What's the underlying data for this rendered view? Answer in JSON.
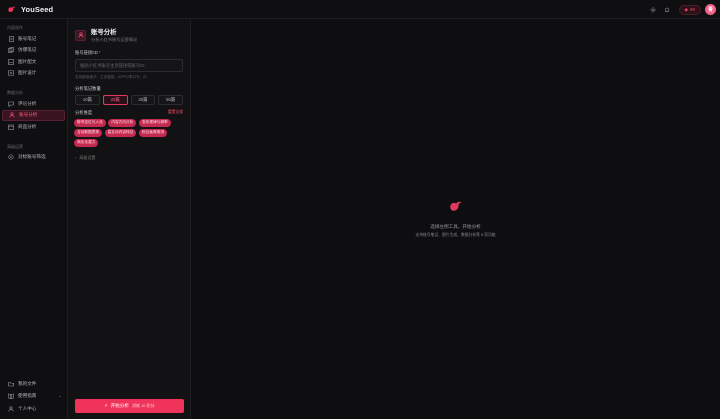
{
  "app": {
    "name": "YouSeed"
  },
  "topbar": {
    "credits": "98"
  },
  "user": {
    "avatar_initial": "青"
  },
  "sidebar": {
    "groups": [
      {
        "title": "内容创作",
        "items": [
          {
            "label": "账号笔记",
            "icon": "file-text-icon"
          },
          {
            "label": "仿爆笔记",
            "icon": "copy-icon"
          },
          {
            "label": "图片配文",
            "icon": "image-icon"
          },
          {
            "label": "图片设计",
            "icon": "palette-icon"
          }
        ]
      },
      {
        "title": "数据分析",
        "items": [
          {
            "label": "评论分析",
            "icon": "message-icon"
          },
          {
            "label": "账号分析",
            "icon": "user-chart-icon",
            "active": true
          },
          {
            "label": "商品分析",
            "icon": "package-icon"
          }
        ]
      },
      {
        "title": "高级运营",
        "items": [
          {
            "label": "对标账号筛选",
            "icon": "target-icon"
          }
        ]
      }
    ],
    "bottom": [
      {
        "label": "我的文件",
        "icon": "folder-icon"
      },
      {
        "label": "使用指南",
        "icon": "book-icon",
        "chevron": "⌄"
      },
      {
        "label": "个人中心",
        "icon": "user-icon"
      }
    ]
  },
  "panel": {
    "title": "账号分析",
    "subtitle": "分析小红书账号运营情况",
    "url_label": "账号链接/ID",
    "url_required_mark": "*",
    "url_placeholder": "粘贴小红书账号主页链接或账号ID",
    "url_hint": "支持链接格式：主页链接、APP分享口令、ID",
    "notes_label": "分析笔记数量",
    "notes_options": [
      {
        "label": "10篇",
        "active": false
      },
      {
        "label": "20篇",
        "active": true
      },
      {
        "label": "30篇",
        "active": false
      },
      {
        "label": "50篇",
        "active": false
      }
    ],
    "dims_label": "分析维度",
    "dims_clear": "重置全部",
    "dims": [
      "账号定位与人设",
      "内容方向分析",
      "发布规律与频率",
      "互动数据表现",
      "高互动内容特征",
      "粉丝画像推测",
      "商业化潜力"
    ],
    "advanced_label": "高级设置",
    "start_label": "开始分析",
    "start_cost": "消耗 10 积分"
  },
  "main": {
    "empty_title": "选择左侧工具，开始分析",
    "empty_subtitle": "支持账号笔记、图片生成、数据分析等 8 项功能"
  },
  "colors": {
    "accent": "#f0335a",
    "chip": "#c4294f",
    "background": "#0e0e10"
  }
}
